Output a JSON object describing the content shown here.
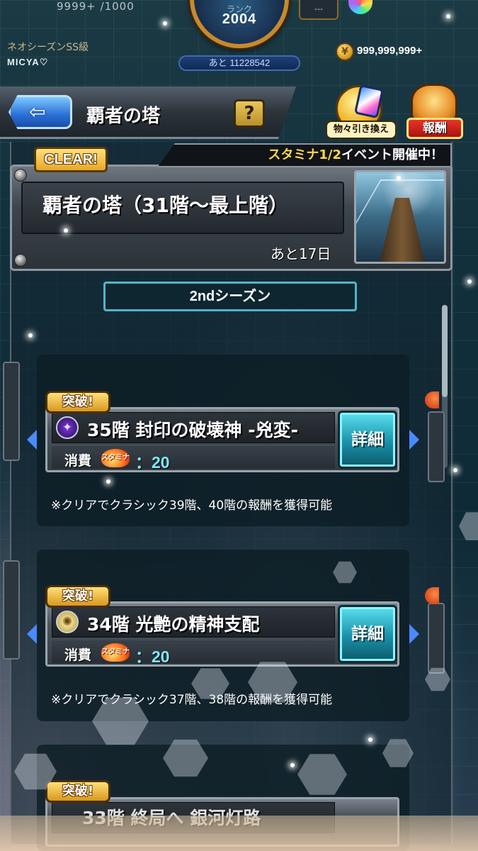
{
  "top": {
    "stat_fragment": "9999+ /1000",
    "rank_label": "ランク",
    "rank": "2004",
    "rank_next": "あと 11228542",
    "box_label": "---",
    "player_title": "ネオシーズンSS級",
    "player_name": "MICYA♡",
    "coin_symbol": "¥",
    "coins": "999,999,999+"
  },
  "header": {
    "back_arrow": "⇦",
    "title": "覇者の塔",
    "help_label": "?",
    "exchange_label": "物々引き換え",
    "reward_label": "報酬"
  },
  "event": {
    "clear_badge": "CLEAR!",
    "stamina_highlight": "スタミナ1/2",
    "stamina_rest": "イベント開催中！",
    "title": "覇者の塔（31階～最上階）",
    "remaining": "あと17日"
  },
  "season_tab": "2ndシーズン",
  "stages": [
    {
      "badge": "突破!",
      "icon": "✦",
      "name": "35階 封印の破壊神 -兇変-",
      "cost_label": "消費",
      "stamina_text": "スタミナ",
      "cost": "：20",
      "detail_label": "詳細",
      "note": "※クリアでクラシック39階、40階の報酬を獲得可能"
    },
    {
      "badge": "突破!",
      "icon": "✺",
      "name": "34階 光艶の精神支配",
      "cost_label": "消費",
      "stamina_text": "スタミナ",
      "cost": "：20",
      "detail_label": "詳細",
      "note": "※クリアでクラシック37階、38階の報酬を獲得可能"
    },
    {
      "badge": "突破!",
      "name": "33階 終局へ 銀河灯路"
    }
  ],
  "colors": {
    "accent_cyan": "#4fb6c8",
    "gold": "#ffd84a",
    "cost_blue": "#7fe8ff",
    "nav_blue": "#4a8aff"
  },
  "icons": [
    "back-arrow-icon",
    "help-icon",
    "coin-icon",
    "gem-icon",
    "dragon-icon",
    "dark-element-icon",
    "light-element-icon",
    "stamina-icon"
  ]
}
